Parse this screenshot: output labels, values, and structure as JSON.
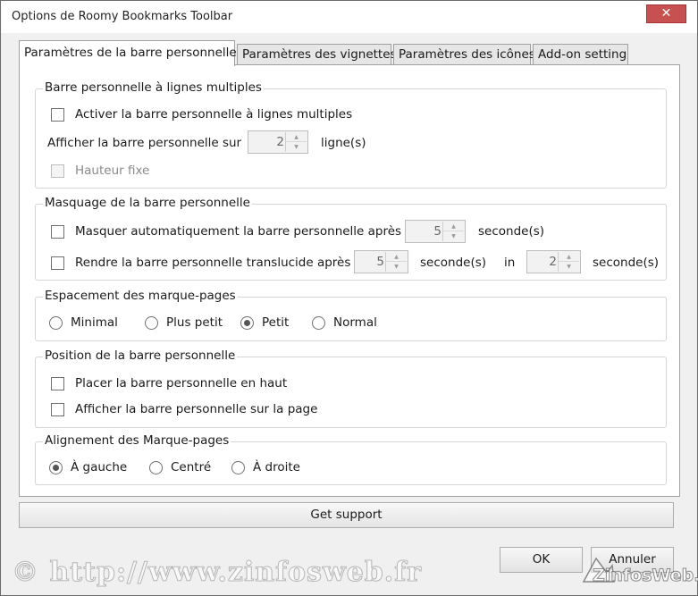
{
  "window": {
    "title": "Options de Roomy Bookmarks Toolbar",
    "close_glyph": "✕"
  },
  "tabs": [
    {
      "label": "Paramètres de la barre personnelle",
      "active": true
    },
    {
      "label": "Paramètres des vignettes",
      "active": false
    },
    {
      "label": "Paramètres des icônes",
      "active": false
    },
    {
      "label": "Add-on setting",
      "active": false
    }
  ],
  "multiline": {
    "title": "Barre personnelle à lignes multiples",
    "enable_label": "Activer la barre personnelle à lignes multiples",
    "enable_checked": false,
    "show_on_label": "Afficher la barre personnelle sur",
    "lines_value": "2",
    "lines_unit": "ligne(s)",
    "fixed_height_label": "Hauteur fixe",
    "fixed_height_checked": false
  },
  "hiding": {
    "title": "Masquage de la barre personnelle",
    "autohide_label": "Masquer automatiquement la barre personnelle après",
    "autohide_checked": false,
    "autohide_value": "5",
    "autohide_unit": "seconde(s)",
    "translucent_label": "Rendre la barre personnelle translucide après",
    "translucent_checked": false,
    "translucent_value": "5",
    "translucent_unit": "seconde(s)",
    "in_label": "in",
    "in_value": "2",
    "in_unit": "seconde(s)"
  },
  "spacing": {
    "title": "Espacement des marque-pages",
    "options": [
      "Minimal",
      "Plus petit",
      "Petit",
      "Normal"
    ],
    "selected": "Petit"
  },
  "position": {
    "title": "Position de la barre personnelle",
    "top_label": "Placer la barre personnelle en haut",
    "top_checked": false,
    "on_page_label": "Afficher la barre personnelle sur la page",
    "on_page_checked": false
  },
  "alignment": {
    "title": "Alignement des Marque-pages",
    "options": [
      "À gauche",
      "Centré",
      "À droite"
    ],
    "selected": "À gauche"
  },
  "buttons": {
    "support": "Get support",
    "ok": "OK",
    "cancel": "Annuler"
  },
  "watermark": {
    "text": "© http://www.zinfosweb.fr",
    "brand": "ZinfosWeb.fr"
  }
}
